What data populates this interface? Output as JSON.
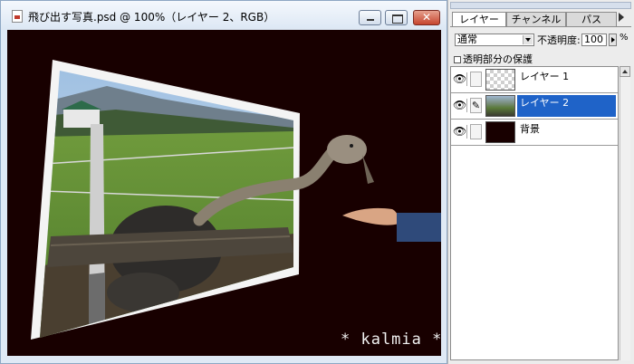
{
  "document": {
    "title": "飛び出す写真.psd @ 100%（レイヤー 2、RGB）",
    "watermark": "* kalmia *"
  },
  "layers_palette": {
    "tabs": [
      {
        "label": "レイヤー",
        "active": true
      },
      {
        "label": "チャンネル",
        "active": false
      },
      {
        "label": "パス",
        "active": false
      }
    ],
    "blend_mode": "通常",
    "opacity_label": "不透明度:",
    "opacity_value": "100",
    "opacity_unit": "%",
    "lock_transparency_label": "透明部分の保護",
    "layers": [
      {
        "name": "レイヤー 1",
        "thumbnail": "transparent-checker",
        "visible": true,
        "selected": false,
        "link_icon": ""
      },
      {
        "name": "レイヤー 2",
        "thumbnail": "photo",
        "visible": true,
        "selected": true,
        "link_icon": "brush-icon"
      },
      {
        "name": "背景",
        "thumbnail": "dark",
        "visible": true,
        "selected": false,
        "link_icon": ""
      }
    ]
  },
  "colors": {
    "canvas_background": "#180000",
    "selection": "#1f63c8",
    "close_button": "#c6452e"
  }
}
